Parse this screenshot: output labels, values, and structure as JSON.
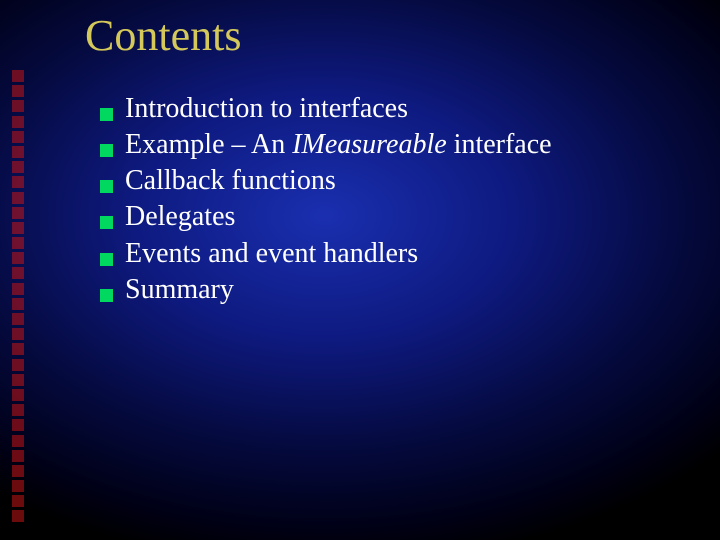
{
  "slide": {
    "title": "Contents",
    "bullets": [
      {
        "html": "Introduction to interfaces"
      },
      {
        "html": "Example – An  <em>IMeasureable</em> interface"
      },
      {
        "html": "Callback functions"
      },
      {
        "html": "Delegates"
      },
      {
        "html": "Events and event handlers"
      },
      {
        "html": "Summary"
      }
    ],
    "colors": {
      "title": "#d4c85a",
      "bullet": "#00d860",
      "deco": "#c41414",
      "text": "#ffffff"
    }
  }
}
